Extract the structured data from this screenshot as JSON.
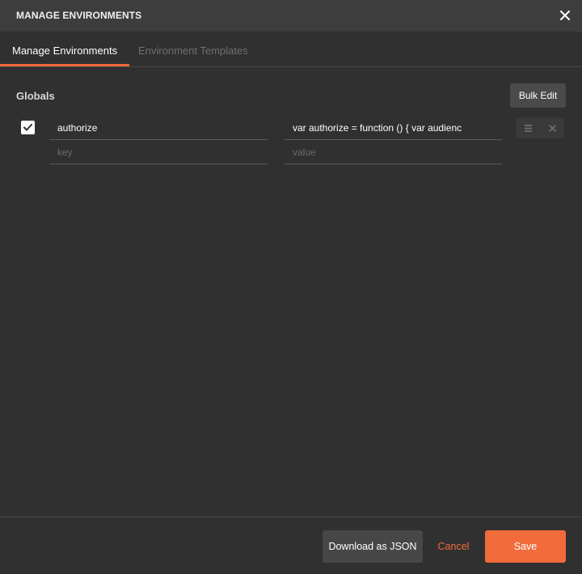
{
  "header": {
    "title": "MANAGE ENVIRONMENTS",
    "close_icon": "close-icon"
  },
  "tabs": [
    {
      "label": "Manage Environments",
      "active": true
    },
    {
      "label": "Environment Templates",
      "active": false
    }
  ],
  "section": {
    "label": "Globals",
    "bulk_edit_label": "Bulk Edit"
  },
  "variables": [
    {
      "enabled": true,
      "key": "authorize",
      "value": "var authorize = function () {    var audienc"
    }
  ],
  "new_row": {
    "key_placeholder": "key",
    "value_placeholder": "value"
  },
  "row_actions": {
    "menu_icon": "hamburger-icon",
    "delete_icon": "close-icon"
  },
  "footer": {
    "download_label": "Download as JSON",
    "cancel_label": "Cancel",
    "save_label": "Save"
  },
  "colors": {
    "accent": "#f26b3a",
    "background": "#303030",
    "header": "#3d3d3d"
  }
}
